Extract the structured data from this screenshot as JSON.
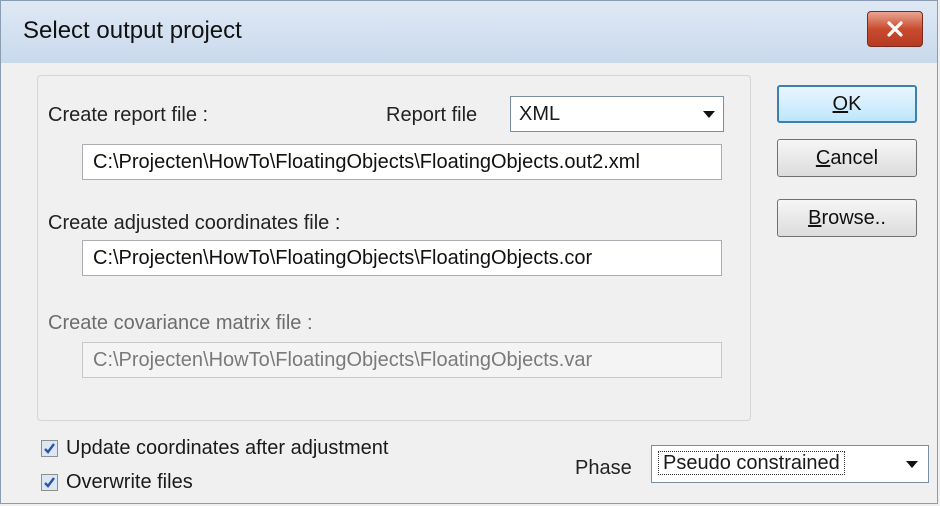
{
  "window": {
    "title": "Select output project"
  },
  "report": {
    "label": "Create report file :",
    "type_label": "Report file",
    "type_value": "XML",
    "path": "C:\\Projecten\\HowTo\\FloatingObjects\\FloatingObjects.out2.xml"
  },
  "coords": {
    "label": "Create adjusted coordinates file :",
    "path": "C:\\Projecten\\HowTo\\FloatingObjects\\FloatingObjects.cor"
  },
  "covariance": {
    "label": "Create covariance matrix file :",
    "path": "C:\\Projecten\\HowTo\\FloatingObjects\\FloatingObjects.var",
    "enabled": false
  },
  "buttons": {
    "ok_mnemonic": "O",
    "ok_rest": "K",
    "cancel_mnemonic": "C",
    "cancel_rest": "ancel",
    "browse_mnemonic": "B",
    "browse_rest": "rowse.."
  },
  "options": {
    "update_coords_label": "Update coordinates after adjustment",
    "update_coords_checked": true,
    "overwrite_label": "Overwrite files",
    "overwrite_checked": true
  },
  "phase": {
    "label": "Phase",
    "value": "Pseudo constrained"
  },
  "icons": {
    "close": "close-icon",
    "check": "check-icon",
    "dropdown": "chevron-down-icon"
  }
}
